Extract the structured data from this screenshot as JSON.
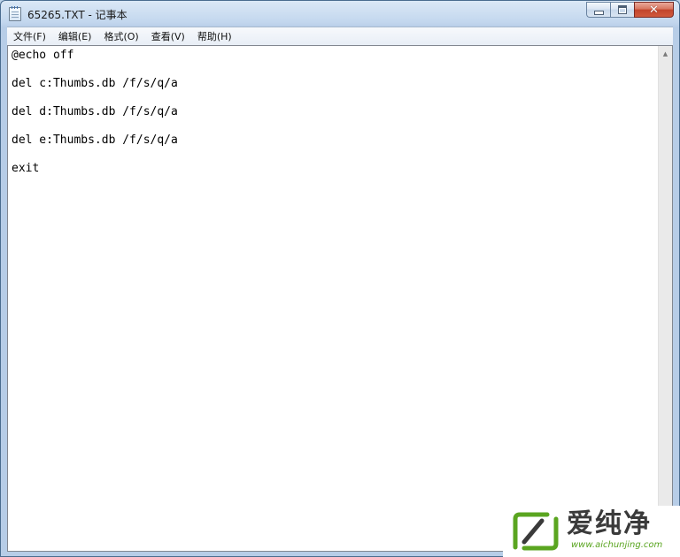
{
  "window": {
    "title": "65265.TXT - 记事本",
    "icon": "notepad-icon",
    "controls": {
      "minimize_icon": "minimize-icon",
      "maximize_icon": "maximize-icon",
      "close_icon": "close-icon",
      "close_glyph": "✕"
    }
  },
  "menu": {
    "items": [
      {
        "label": "文件(F)"
      },
      {
        "label": "编辑(E)"
      },
      {
        "label": "格式(O)"
      },
      {
        "label": "查看(V)"
      },
      {
        "label": "帮助(H)"
      }
    ]
  },
  "editor": {
    "content": "@echo off\n\ndel c:Thumbs.db /f/s/q/a\n\ndel d:Thumbs.db /f/s/q/a\n\ndel e:Thumbs.db /f/s/q/a\n\nexit"
  },
  "scrollbar": {
    "up_glyph": "▲",
    "down_glyph": "▼"
  },
  "watermark": {
    "title": "爱纯净",
    "url": "www.aichunjing.com"
  },
  "colors": {
    "accent_green": "#5aa520",
    "close_red": "#c2452c",
    "title_bar": "#c3d7ee"
  }
}
